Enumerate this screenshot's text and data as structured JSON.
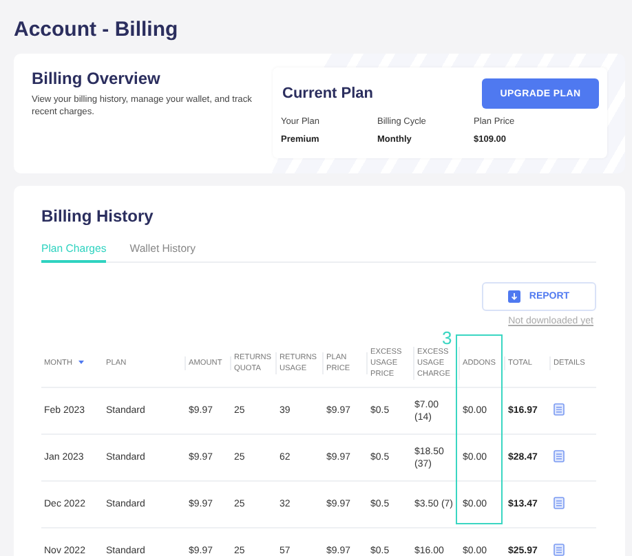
{
  "page": {
    "title": "Account - Billing"
  },
  "overview": {
    "title": "Billing Overview",
    "description": "View your billing history, manage your wallet, and track recent charges.",
    "current_plan": {
      "title": "Current Plan",
      "button": "UPGRADE PLAN",
      "fields": [
        {
          "label": "Your Plan",
          "value": "Premium"
        },
        {
          "label": "Billing Cycle",
          "value": "Monthly"
        },
        {
          "label": "Plan Price",
          "value": "$109.00"
        }
      ]
    }
  },
  "history": {
    "title": "Billing History",
    "tabs": [
      {
        "label": "Plan Charges",
        "selected": true
      },
      {
        "label": "Wallet History",
        "selected": false
      }
    ],
    "report_button": "REPORT",
    "report_status": "Not downloaded yet",
    "table": {
      "columns": [
        {
          "label": "MONTH",
          "sorted": true
        },
        {
          "label": "PLAN",
          "sorted": false
        },
        {
          "label": "AMOUNT",
          "sorted": false
        },
        {
          "label": "RETURNS QUOTA",
          "sorted": false
        },
        {
          "label": "RETURNS USAGE",
          "sorted": false
        },
        {
          "label": "PLAN PRICE",
          "sorted": false
        },
        {
          "label": "EXCESS USAGE PRICE",
          "sorted": false
        },
        {
          "label": "EXCESS USAGE CHARGE",
          "sorted": false
        },
        {
          "label": "ADDONS",
          "sorted": false,
          "callout": "3"
        },
        {
          "label": "TOTAL",
          "sorted": false
        },
        {
          "label": "DETAILS",
          "sorted": false
        }
      ],
      "rows": [
        {
          "cells": [
            "Feb 2023",
            "Standard",
            "$9.97",
            "25",
            "39",
            "$9.97",
            "$0.5",
            "$7.00 (14)",
            "$0.00",
            "$16.97"
          ]
        },
        {
          "cells": [
            "Jan 2023",
            "Standard",
            "$9.97",
            "25",
            "62",
            "$9.97",
            "$0.5",
            "$18.50 (37)",
            "$0.00",
            "$28.47"
          ]
        },
        {
          "cells": [
            "Dec 2022",
            "Standard",
            "$9.97",
            "25",
            "32",
            "$9.97",
            "$0.5",
            "$3.50 (7)",
            "$0.00",
            "$13.47"
          ]
        },
        {
          "cells": [
            "Nov 2022",
            "Standard",
            "$9.97",
            "25",
            "57",
            "$9.97",
            "$0.5",
            "$16.00",
            "$0.00",
            "$25.97"
          ]
        }
      ]
    }
  }
}
